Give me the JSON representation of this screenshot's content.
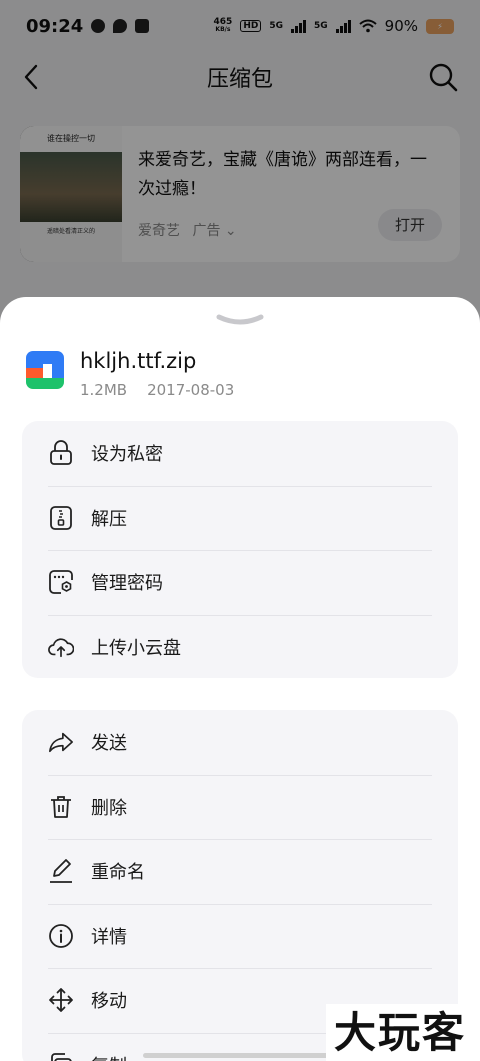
{
  "status_bar": {
    "time": "09:24",
    "net_speed_value": "465",
    "net_speed_unit": "KB/s",
    "hd_label": "HD",
    "signal_1": "5G",
    "signal_2": "5G",
    "battery_percent": "90%"
  },
  "header": {
    "title": "压缩包"
  },
  "ad": {
    "thumb_top_text": "谁在操控一切",
    "thumb_bottom_text": "遥暗处看清正义的",
    "text": "来爱奇艺，宝藏《唐诡》两部连看，一次过瘾！",
    "source": "爱奇艺",
    "tag": "广告",
    "open_label": "打开"
  },
  "file": {
    "name": "hkljh.ttf.zip",
    "size": "1.2MB",
    "date": "2017-08-03",
    "icon_colors": [
      "#2f7bf5",
      "#ff5a2c",
      "#1ec26b"
    ]
  },
  "menu_group_1": [
    {
      "label": "设为私密",
      "icon": "lock-icon"
    },
    {
      "label": "解压",
      "icon": "unzip-icon"
    },
    {
      "label": "管理密码",
      "icon": "password-manage-icon"
    },
    {
      "label": "上传小云盘",
      "icon": "cloud-upload-icon"
    }
  ],
  "menu_group_2": [
    {
      "label": "发送",
      "icon": "share-icon"
    },
    {
      "label": "删除",
      "icon": "trash-icon"
    },
    {
      "label": "重命名",
      "icon": "pencil-icon"
    },
    {
      "label": "详情",
      "icon": "info-icon"
    },
    {
      "label": "移动",
      "icon": "move-icon"
    },
    {
      "label": "复制",
      "icon": "copy-icon"
    }
  ],
  "watermark": "大玩客"
}
